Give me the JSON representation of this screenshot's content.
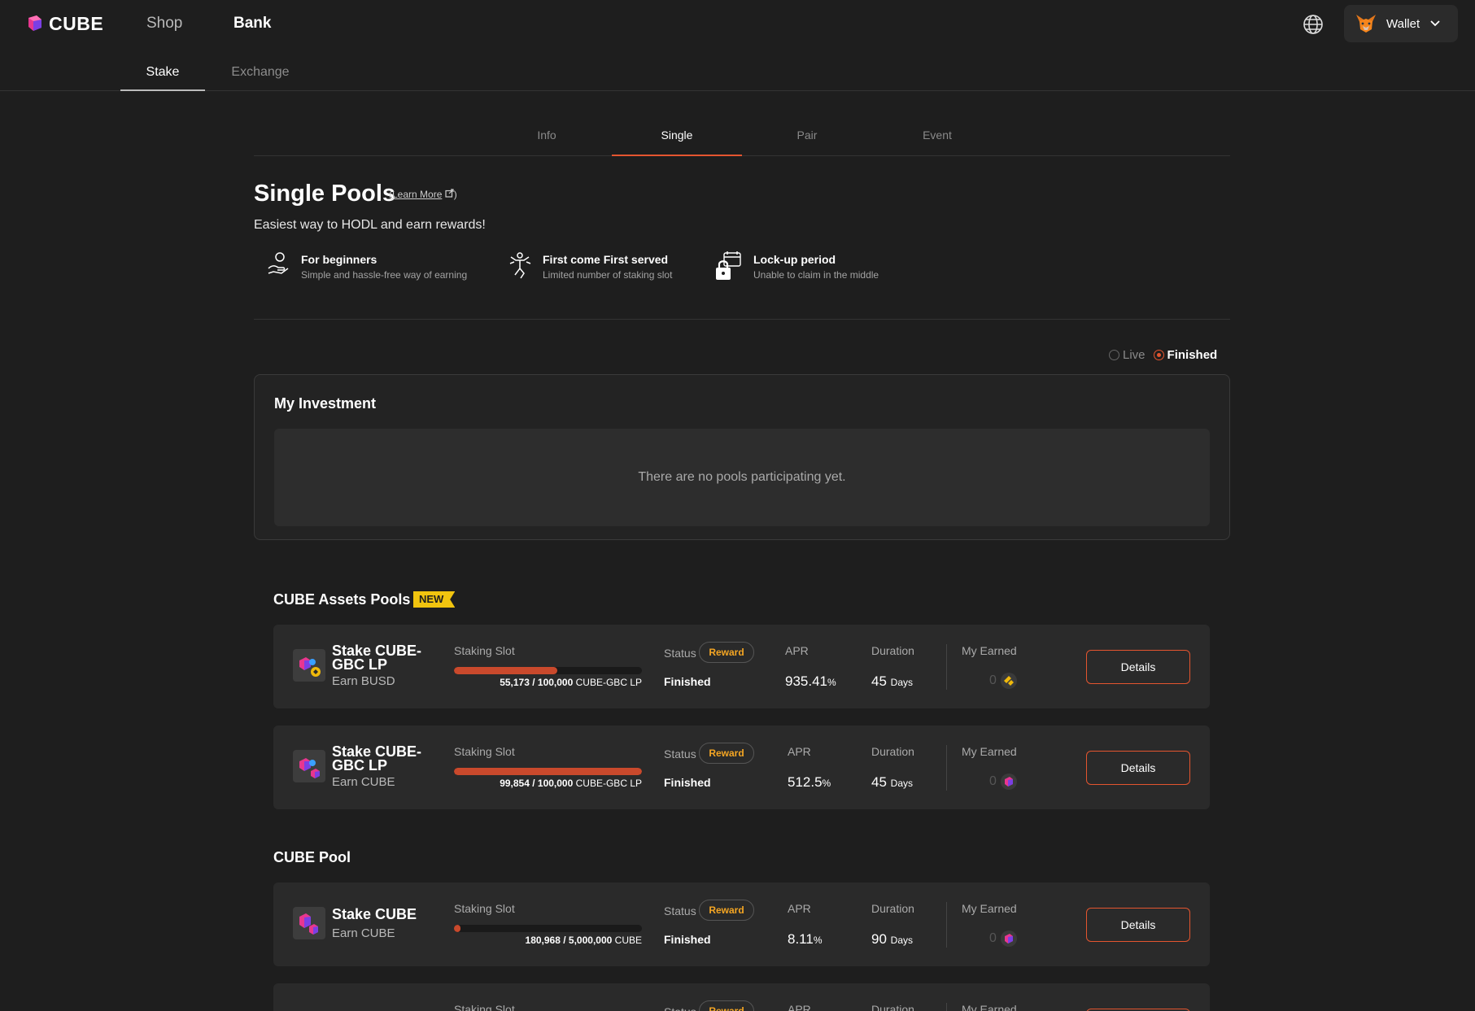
{
  "header": {
    "logo_text": "CUBE",
    "nav": [
      {
        "label": "Shop"
      },
      {
        "label": "Bank"
      }
    ],
    "wallet_label": "Wallet"
  },
  "subnav": [
    {
      "label": "Stake"
    },
    {
      "label": "Exchange"
    }
  ],
  "tabs": [
    {
      "label": "Info"
    },
    {
      "label": "Single"
    },
    {
      "label": "Pair"
    },
    {
      "label": "Event"
    }
  ],
  "page": {
    "title": "Single Pools",
    "learn_more": "Learn More",
    "tagline": "Easiest way to HODL and earn rewards!"
  },
  "features": [
    {
      "icon": "hand-coin-icon",
      "title": "For beginners",
      "desc": "Simple and hassle-free way of earning"
    },
    {
      "icon": "runner-icon",
      "title": "First come First served",
      "desc": "Limited number of staking slot"
    },
    {
      "icon": "lock-calendar-icon",
      "title": "Lock-up period",
      "desc": "Unable to claim in the middle"
    }
  ],
  "filter": {
    "live": "Live",
    "finished": "Finished",
    "selected": "Finished"
  },
  "investment": {
    "title": "My Investment",
    "empty": "There are no pools participating yet."
  },
  "sections": {
    "assets_title": "CUBE Assets Pools",
    "new_badge": "NEW",
    "cube_pool_title": "CUBE Pool"
  },
  "labels": {
    "staking_slot": "Staking Slot",
    "status": "Status",
    "apr": "APR",
    "duration": "Duration",
    "my_earned": "My Earned",
    "reward": "Reward",
    "details": "Details"
  },
  "pools": [
    {
      "name": "Stake CUBE-GBC LP",
      "earn": "Earn BUSD",
      "slot_used": "55,173",
      "slot_total": "100,000",
      "slot_unit": "CUBE-GBC LP",
      "fill": 0.55,
      "status": "Finished",
      "apr": "935.41",
      "apr_unit": "%",
      "duration": "45",
      "duration_unit": "Days",
      "earned": "0",
      "coin": "busd"
    },
    {
      "name": "Stake CUBE-GBC LP",
      "earn": "Earn CUBE",
      "slot_used": "99,854",
      "slot_total": "100,000",
      "slot_unit": "CUBE-GBC LP",
      "fill": 0.9985,
      "status": "Finished",
      "apr": "512.5",
      "apr_unit": "%",
      "duration": "45",
      "duration_unit": "Days",
      "earned": "0",
      "coin": "cube"
    },
    {
      "name": "Stake CUBE",
      "earn": "Earn CUBE",
      "slot_used": "180,968",
      "slot_total": "5,000,000",
      "slot_unit": "CUBE",
      "fill": 0.036,
      "status": "Finished",
      "apr": "8.11",
      "apr_unit": "%",
      "duration": "90",
      "duration_unit": "Days",
      "earned": "0",
      "coin": "cube"
    }
  ],
  "colors": {
    "accent": "#e4552f",
    "reward": "#f5a623",
    "new_badge": "#f1c40f",
    "cube_purple": "#7b3fe4",
    "cube_pink": "#e8368f"
  }
}
